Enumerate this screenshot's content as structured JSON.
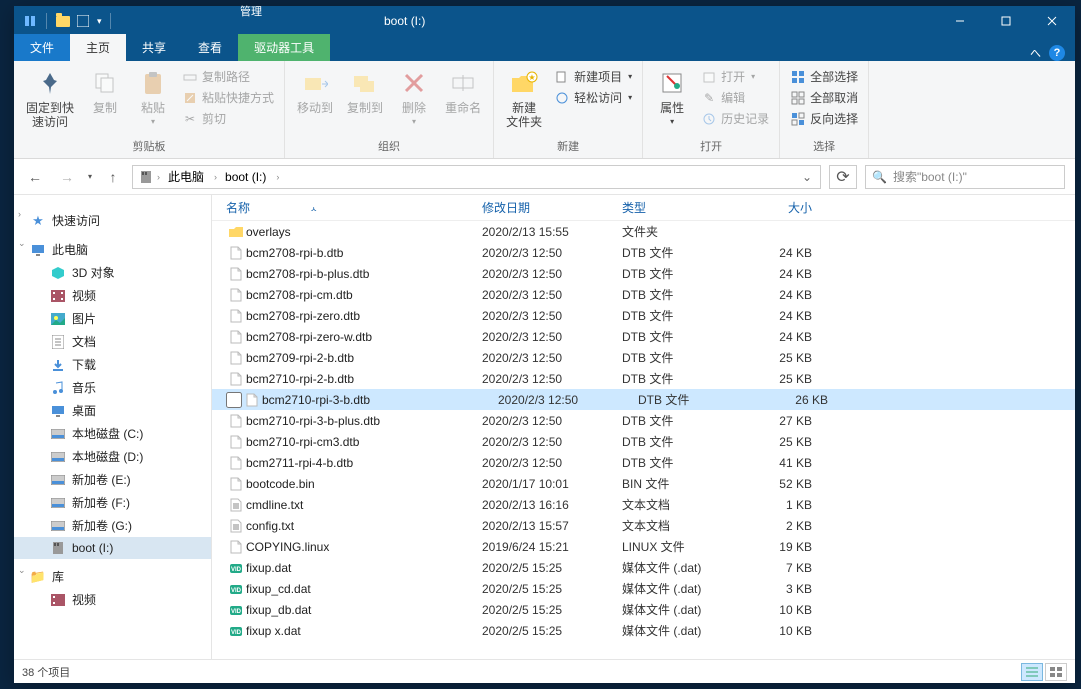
{
  "titlebar": {
    "contextual_group": "管理",
    "title": "boot (I:)",
    "controls": {
      "min": "—",
      "max": "☐",
      "close": "✕"
    }
  },
  "tabs": {
    "file": "文件",
    "home": "主页",
    "share": "共享",
    "view": "查看",
    "drive_tools": "驱动器工具"
  },
  "ribbon": {
    "pin": "固定到快\n速访问",
    "copy": "复制",
    "paste": "粘贴",
    "copy_path": "复制路径",
    "paste_shortcut": "粘贴快捷方式",
    "cut": "剪切",
    "group_clipboard": "剪贴板",
    "move_to": "移动到",
    "copy_to": "复制到",
    "delete": "删除",
    "rename": "重命名",
    "group_organize": "组织",
    "new_folder": "新建\n文件夹",
    "new_item": "新建项目",
    "easy_access": "轻松访问",
    "group_new": "新建",
    "properties": "属性",
    "open": "打开",
    "edit": "编辑",
    "history": "历史记录",
    "group_open": "打开",
    "select_all": "全部选择",
    "select_none": "全部取消",
    "invert_selection": "反向选择",
    "group_select": "选择"
  },
  "nav": {
    "this_pc": "此电脑",
    "location": "boot (I:)"
  },
  "search": {
    "placeholder": "搜索\"boot (I:)\""
  },
  "sidebar": {
    "quick_access": "快速访问",
    "this_pc": "此电脑",
    "items": [
      {
        "label": "3D 对象",
        "icon": "cube"
      },
      {
        "label": "视频",
        "icon": "video"
      },
      {
        "label": "图片",
        "icon": "picture"
      },
      {
        "label": "文档",
        "icon": "doc"
      },
      {
        "label": "下载",
        "icon": "download"
      },
      {
        "label": "音乐",
        "icon": "music"
      },
      {
        "label": "桌面",
        "icon": "desktop"
      },
      {
        "label": "本地磁盘 (C:)",
        "icon": "disk"
      },
      {
        "label": "本地磁盘 (D:)",
        "icon": "disk"
      },
      {
        "label": "新加卷 (E:)",
        "icon": "disk"
      },
      {
        "label": "新加卷 (F:)",
        "icon": "disk"
      },
      {
        "label": "新加卷 (G:)",
        "icon": "disk"
      },
      {
        "label": "boot (I:)",
        "icon": "sd",
        "selected": true
      }
    ],
    "library": "库",
    "lib_video": "视频"
  },
  "columns": {
    "name": "名称",
    "date": "修改日期",
    "type": "类型",
    "size": "大小"
  },
  "files": [
    {
      "name": "overlays",
      "date": "2020/2/13 15:55",
      "type": "文件夹",
      "size": "",
      "icon": "folder"
    },
    {
      "name": "bcm2708-rpi-b.dtb",
      "date": "2020/2/3 12:50",
      "type": "DTB 文件",
      "size": "24 KB",
      "icon": "file"
    },
    {
      "name": "bcm2708-rpi-b-plus.dtb",
      "date": "2020/2/3 12:50",
      "type": "DTB 文件",
      "size": "24 KB",
      "icon": "file"
    },
    {
      "name": "bcm2708-rpi-cm.dtb",
      "date": "2020/2/3 12:50",
      "type": "DTB 文件",
      "size": "24 KB",
      "icon": "file"
    },
    {
      "name": "bcm2708-rpi-zero.dtb",
      "date": "2020/2/3 12:50",
      "type": "DTB 文件",
      "size": "24 KB",
      "icon": "file"
    },
    {
      "name": "bcm2708-rpi-zero-w.dtb",
      "date": "2020/2/3 12:50",
      "type": "DTB 文件",
      "size": "24 KB",
      "icon": "file"
    },
    {
      "name": "bcm2709-rpi-2-b.dtb",
      "date": "2020/2/3 12:50",
      "type": "DTB 文件",
      "size": "25 KB",
      "icon": "file"
    },
    {
      "name": "bcm2710-rpi-2-b.dtb",
      "date": "2020/2/3 12:50",
      "type": "DTB 文件",
      "size": "25 KB",
      "icon": "file"
    },
    {
      "name": "bcm2710-rpi-3-b.dtb",
      "date": "2020/2/3 12:50",
      "type": "DTB 文件",
      "size": "26 KB",
      "icon": "file",
      "selected": true
    },
    {
      "name": "bcm2710-rpi-3-b-plus.dtb",
      "date": "2020/2/3 12:50",
      "type": "DTB 文件",
      "size": "27 KB",
      "icon": "file"
    },
    {
      "name": "bcm2710-rpi-cm3.dtb",
      "date": "2020/2/3 12:50",
      "type": "DTB 文件",
      "size": "25 KB",
      "icon": "file"
    },
    {
      "name": "bcm2711-rpi-4-b.dtb",
      "date": "2020/2/3 12:50",
      "type": "DTB 文件",
      "size": "41 KB",
      "icon": "file"
    },
    {
      "name": "bootcode.bin",
      "date": "2020/1/17 10:01",
      "type": "BIN 文件",
      "size": "52 KB",
      "icon": "file"
    },
    {
      "name": "cmdline.txt",
      "date": "2020/2/13 16:16",
      "type": "文本文档",
      "size": "1 KB",
      "icon": "txt"
    },
    {
      "name": "config.txt",
      "date": "2020/2/13 15:57",
      "type": "文本文档",
      "size": "2 KB",
      "icon": "txt"
    },
    {
      "name": "COPYING.linux",
      "date": "2019/6/24 15:21",
      "type": "LINUX 文件",
      "size": "19 KB",
      "icon": "file"
    },
    {
      "name": "fixup.dat",
      "date": "2020/2/5 15:25",
      "type": "媒体文件 (.dat)",
      "size": "7 KB",
      "icon": "dat"
    },
    {
      "name": "fixup_cd.dat",
      "date": "2020/2/5 15:25",
      "type": "媒体文件 (.dat)",
      "size": "3 KB",
      "icon": "dat"
    },
    {
      "name": "fixup_db.dat",
      "date": "2020/2/5 15:25",
      "type": "媒体文件 (.dat)",
      "size": "10 KB",
      "icon": "dat"
    },
    {
      "name": "fixup x.dat",
      "date": "2020/2/5 15:25",
      "type": "媒体文件 (.dat)",
      "size": "10 KB",
      "icon": "dat"
    }
  ],
  "status": {
    "count": "38 个项目"
  }
}
